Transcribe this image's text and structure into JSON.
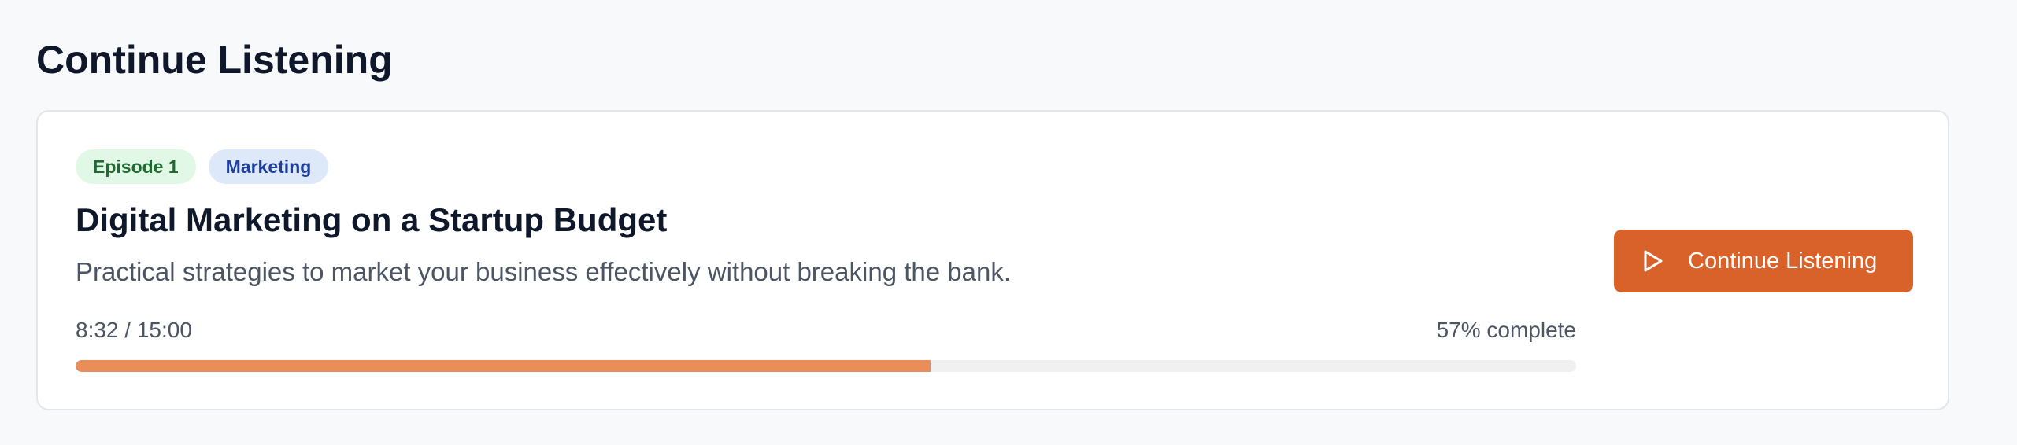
{
  "section": {
    "title": "Continue Listening"
  },
  "episode": {
    "episode_tag": "Episode 1",
    "category_tag": "Marketing",
    "title": "Digital Marketing on a Startup Budget",
    "description": "Practical strategies to market your business effectively without breaking the bank.",
    "time_progress": "8:32 / 15:00",
    "percent_label": "57% complete",
    "progress_fraction": 0.57
  },
  "actions": {
    "continue_label": "Continue Listening",
    "continue_icon": "play-icon"
  },
  "colors": {
    "accent": "#d9622b",
    "progress_fill": "#e98d5b",
    "episode_tag_bg": "#e2f8e7",
    "episode_tag_text": "#1f6b32",
    "category_tag_bg": "#dde8f9",
    "category_tag_text": "#1e3f9f"
  }
}
